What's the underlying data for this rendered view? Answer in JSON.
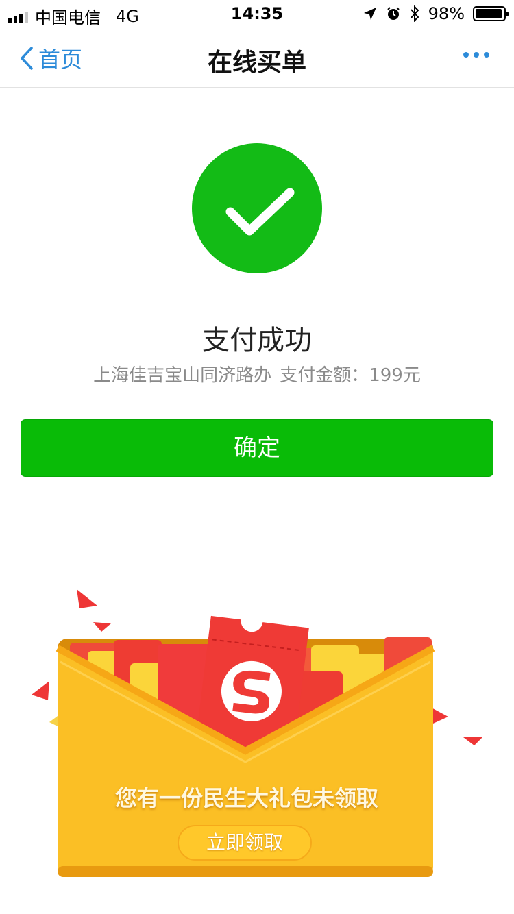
{
  "status_bar": {
    "carrier": "中国电信",
    "network": "4G",
    "time": "14:35",
    "battery": "98%",
    "icons": [
      "signal-icon",
      "location-arrow-icon",
      "alarm-icon",
      "bluetooth-icon",
      "battery-icon"
    ]
  },
  "nav": {
    "back_label": "首页",
    "title": "在线买单",
    "more_icon": "more-dots-icon"
  },
  "result": {
    "icon": "check-circle-icon",
    "title": "支付成功",
    "merchant": "上海佳吉宝山同济路办",
    "amount_label": "支付金额：",
    "amount": "199元"
  },
  "confirm_button": {
    "label": "确定"
  },
  "promo": {
    "text": "您有一份民生大礼包未领取",
    "button_label": "立即领取"
  },
  "colors": {
    "success_green": "#13bb16",
    "button_green": "#09bb07",
    "link_blue": "#2c8bd9",
    "envelope_yellow": "#fbbf25",
    "packet_red": "#f03b3b"
  }
}
